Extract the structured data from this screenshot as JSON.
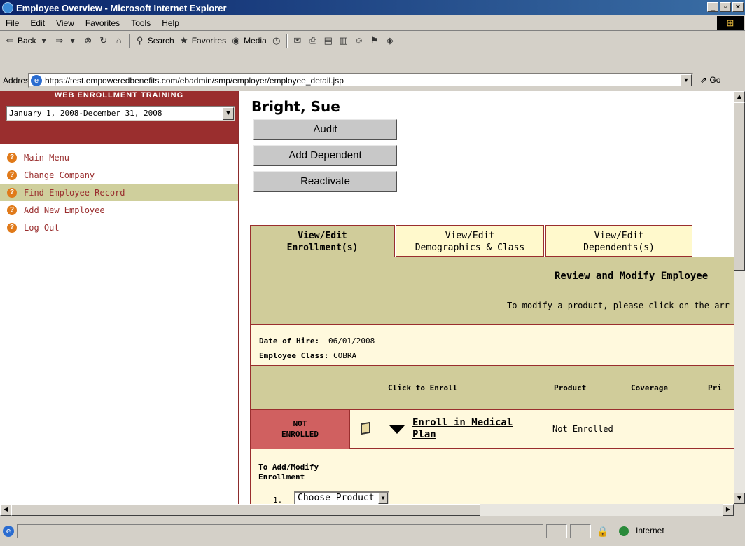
{
  "window": {
    "title": "Employee Overview - Microsoft Internet Explorer",
    "controls": [
      "_",
      "̆",
      "X"
    ]
  },
  "menu": [
    "File",
    "Edit",
    "View",
    "Favorites",
    "Tools",
    "Help"
  ],
  "toolbar": {
    "back": "Back",
    "search": "Search",
    "favorites": "Favorites",
    "media": "Media"
  },
  "address": {
    "label": "Address",
    "url": "https://test.empoweredbenefits.com/ebadmin/smp/employer/employee_detail.jsp",
    "go": "Go"
  },
  "sidebar": {
    "title": "WEB ENROLLMENT TRAINING",
    "plan_year": "January 1, 2008-December 31, 2008",
    "items": [
      {
        "label": "Main Menu"
      },
      {
        "label": "Change Company"
      },
      {
        "label": "Find Employee Record"
      },
      {
        "label": "Add New Employee"
      },
      {
        "label": "Log Out"
      }
    ]
  },
  "employee": {
    "name": "Bright, Sue",
    "buttons": {
      "audit": "Audit",
      "add_dependent": "Add Dependent",
      "reactivate": "Reactivate"
    }
  },
  "tabs": [
    {
      "line1": "View/Edit",
      "line2": "Enrollment(s)",
      "active": true
    },
    {
      "line1": "View/Edit",
      "line2": "Demographics & Class",
      "active": false
    },
    {
      "line1": "View/Edit",
      "line2": "Dependents(s)",
      "active": false
    }
  ],
  "panel": {
    "heading": "Review and Modify Employee",
    "note": "To modify a product, please click on the arr",
    "date_of_hire_label": "Date of Hire:",
    "date_of_hire": "06/01/2008",
    "employee_class_label": "Employee Class:",
    "employee_class": "COBRA"
  },
  "table": {
    "headers": {
      "click_to_enroll": "Click to Enroll",
      "product": "Product",
      "coverage": "Coverage",
      "price": "Pri"
    },
    "row": {
      "status_line1": "NOT",
      "status_line2": "ENROLLED",
      "enroll_link": "Enroll in Medical Plan",
      "product": "Not Enrolled"
    }
  },
  "add_modify": {
    "label_line1": "To Add/Modify",
    "label_line2": "Enrollment",
    "item_number": "1.",
    "choose_product": "Choose Product"
  },
  "statusbar": {
    "zone": "Internet"
  }
}
